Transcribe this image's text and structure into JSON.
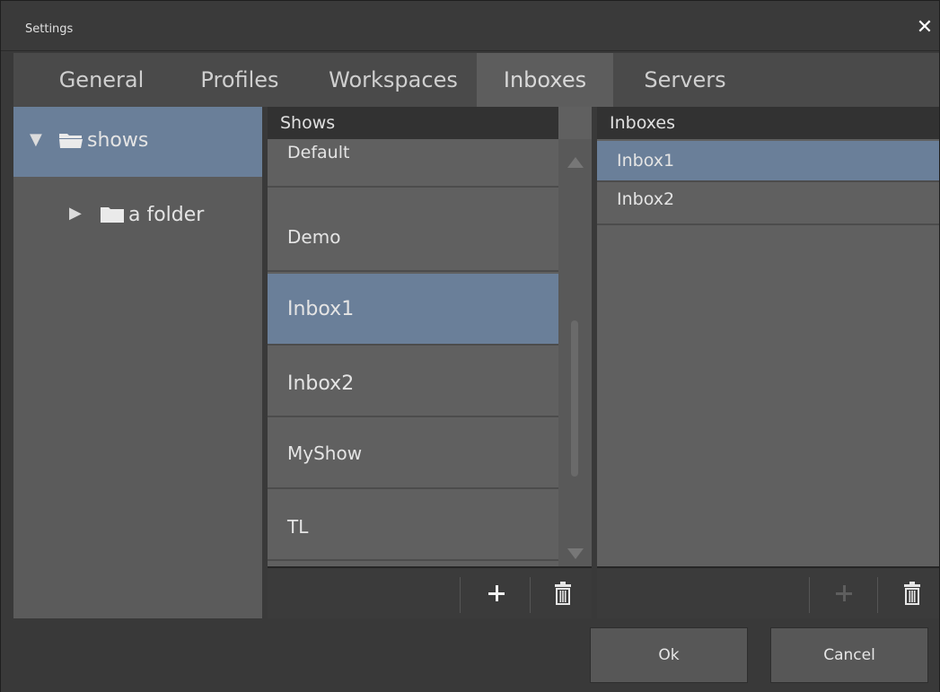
{
  "window": {
    "title": "Settings",
    "close_glyph": "✕"
  },
  "tabs": [
    {
      "label": "General"
    },
    {
      "label": "Profiles"
    },
    {
      "label": "Workspaces"
    },
    {
      "label": "Inboxes",
      "active": true
    },
    {
      "label": "Servers"
    }
  ],
  "tree": {
    "items": [
      {
        "label": "shows",
        "expanded": true,
        "selected": true,
        "icon": "open-folder-icon"
      },
      {
        "label": "a folder",
        "expanded": false,
        "selected": false,
        "icon": "folder-icon"
      }
    ]
  },
  "shows": {
    "header": "Shows",
    "items": [
      {
        "label": "Default"
      },
      {
        "label": "Demo"
      },
      {
        "label": "Inbox1",
        "selected": true
      },
      {
        "label": "Inbox2"
      },
      {
        "label": "MyShow"
      },
      {
        "label": "TL"
      }
    ]
  },
  "inboxes": {
    "header": "Inboxes",
    "items": [
      {
        "label": "Inbox1",
        "selected": true
      },
      {
        "label": "Inbox2"
      }
    ]
  },
  "footer": {
    "ok_label": "Ok",
    "cancel_label": "Cancel"
  },
  "colors": {
    "selection": "#6a7f99",
    "panel": "#606060",
    "header": "#323232"
  }
}
